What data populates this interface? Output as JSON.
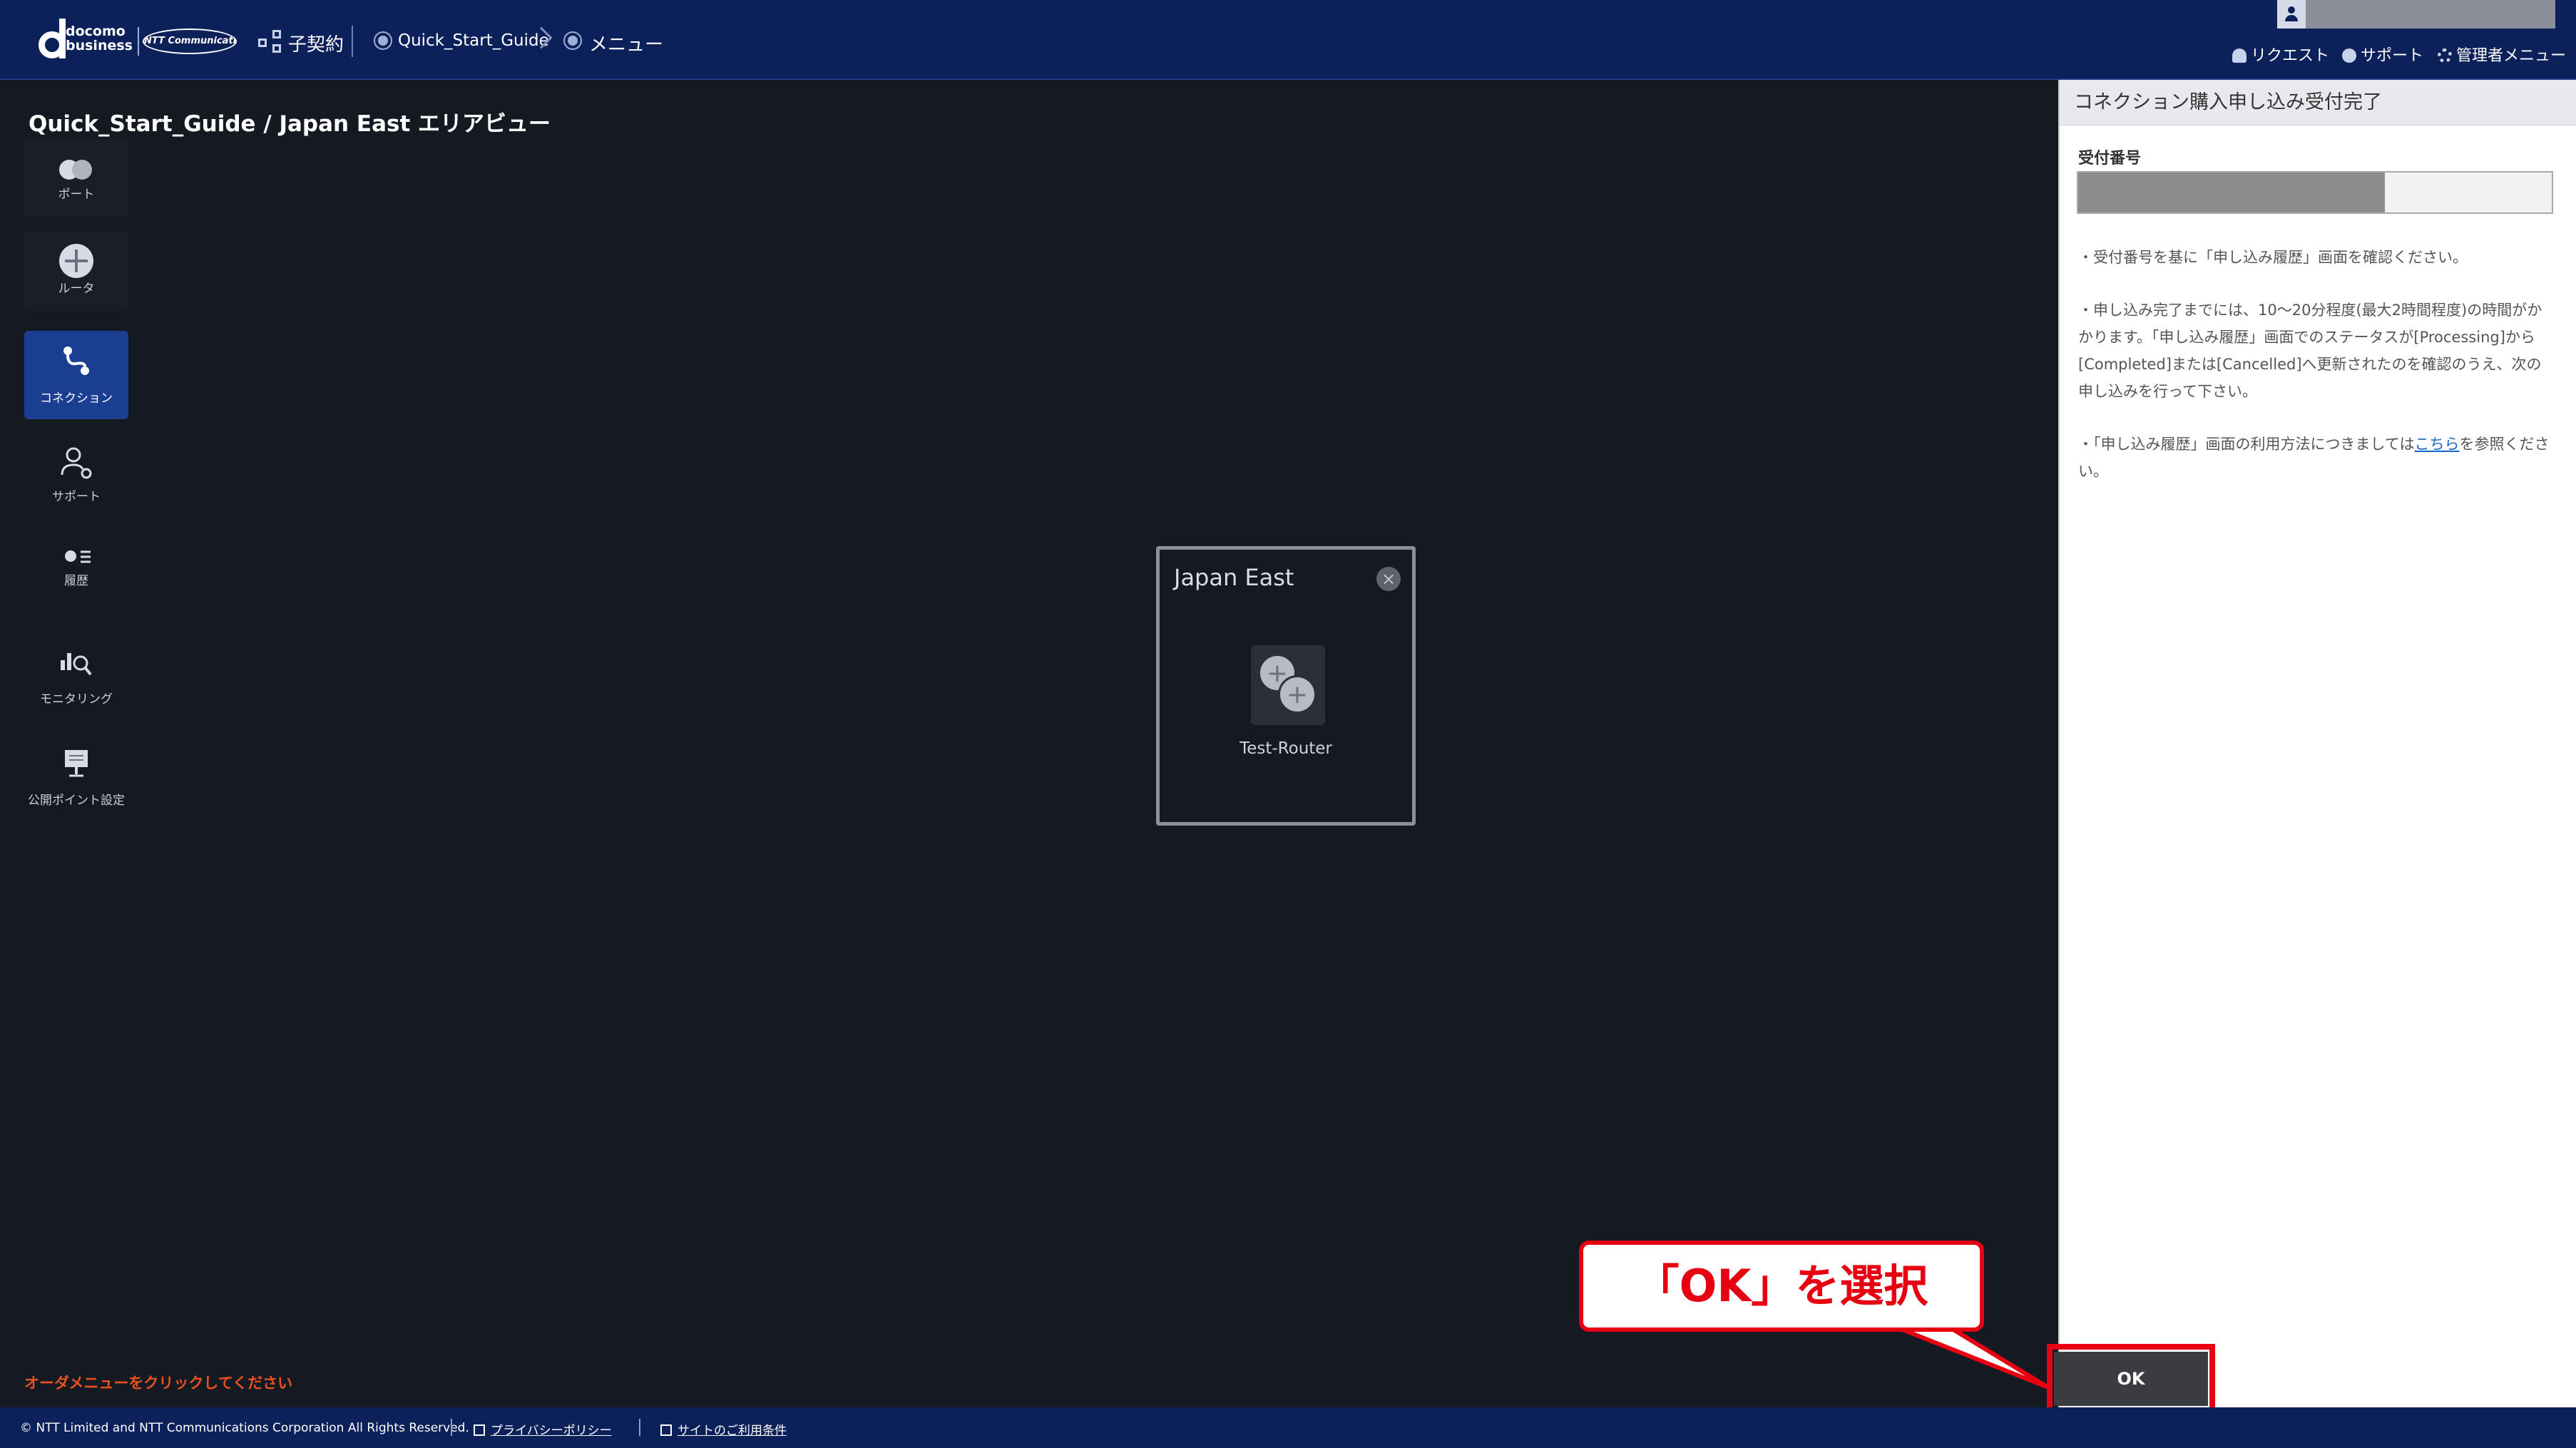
{
  "header": {
    "brand_line1": "docomo",
    "brand_line2": "business",
    "ntt_logo_text": "NTT Communications",
    "contract_label": "子契約",
    "breadcrumb": [
      "Quick_Start_Guide",
      "メニュー"
    ],
    "links": [
      "リクエスト",
      "サポート",
      "管理者メニュー"
    ]
  },
  "page_title": "Quick_Start_Guide / Japan East エリアビュー",
  "sidebar": {
    "items": [
      {
        "label": "ポート",
        "icon": "port-icon"
      },
      {
        "label": "ルータ",
        "icon": "router-icon"
      },
      {
        "label": "コネクション",
        "icon": "connection-icon",
        "active": true
      },
      {
        "label": "サポート",
        "icon": "support-icon"
      },
      {
        "label": "履歴",
        "icon": "history-icon"
      },
      {
        "label": "モニタリング",
        "icon": "monitoring-icon"
      },
      {
        "label": "公開ポイント設定",
        "icon": "public-point-icon"
      }
    ]
  },
  "area_card": {
    "title": "Japan East",
    "close_glyph": "×",
    "router_name": "Test-Router"
  },
  "panel": {
    "title": "コネクション購入申し込み受付完了",
    "field_label": "受付番号",
    "notes": [
      "・受付番号を基に「申し込み履歴」画面を確認ください。",
      "・申し込み完了までには、10～20分程度(最大2時間程度)の時間がかかります。「申し込み履歴」画面でのステータスが[Processing]から[Completed]または[Cancelled]へ更新されたのを確認のうえ、次の申し込みを行って下さい。"
    ],
    "note3_prefix": "・「申し込み履歴」画面の利用方法につきましては",
    "note3_link": "こちら",
    "note3_suffix": "を参照ください。"
  },
  "ok_button": "OK",
  "callout": "「OK」を選択",
  "order_hint": "オーダメニューをクリックしてください",
  "footer": {
    "copyright": "© NTT Limited and NTT Communications Corporation All Rights Reserved.",
    "privacy": "プライバシーポリシー",
    "terms": "サイトのご利用条件"
  },
  "colors": {
    "header_bg": "#0c2159",
    "active_nav": "#1a3f92",
    "highlight_red": "#e60012",
    "hint_orange": "#e8501e"
  }
}
